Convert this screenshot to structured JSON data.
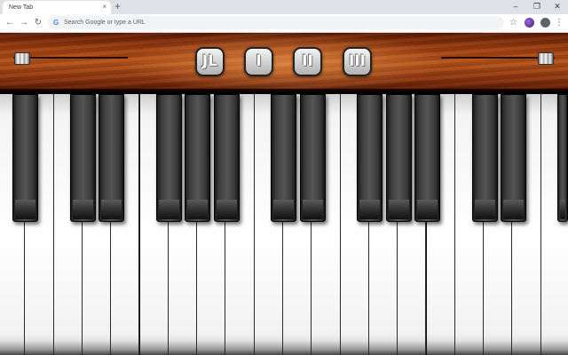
{
  "browser": {
    "tab_title": "New Tab",
    "tab_close": "×",
    "new_tab": "+",
    "window_minimize": "–",
    "window_restore": "❐",
    "window_close": "✕",
    "back": "←",
    "forward": "→",
    "reload": "↻",
    "omnibox_g": "G",
    "omnibox_placeholder": "Search Google or type a URL",
    "bookmark_star": "☆",
    "menu": "⋮"
  },
  "piano": {
    "buttons": [
      {
        "label": "ЈL",
        "name": "mode-button-both"
      },
      {
        "label": "I",
        "name": "mode-button-one"
      },
      {
        "label": "II",
        "name": "mode-button-two"
      },
      {
        "label": "III",
        "name": "mode-button-three"
      }
    ],
    "volume_left_level": 0.0,
    "volume_right_level": 1.0,
    "white_key_count": 20,
    "black_key_groups": "2-3 pattern",
    "colors": {
      "wood_dark": "#5a1a05",
      "wood_light": "#b4541c",
      "black_key": "#3c3c3c",
      "white_key": "#ffffff"
    }
  }
}
